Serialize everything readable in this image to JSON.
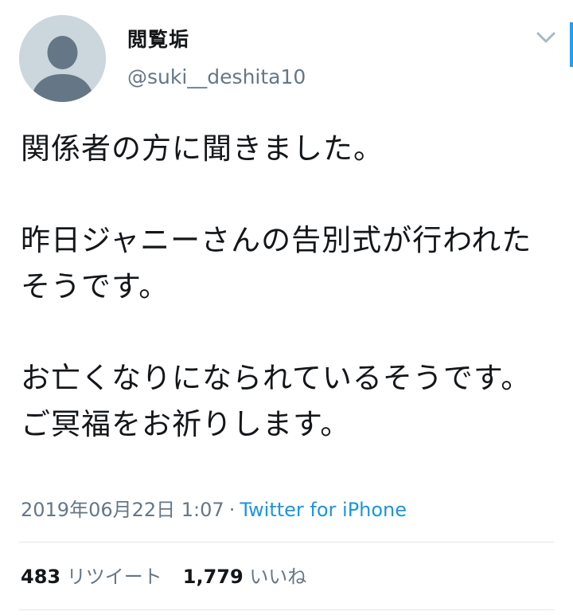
{
  "user": {
    "display_name": "閲覧垢",
    "handle": "@suki__deshita10"
  },
  "tweet": {
    "text": "関係者の方に聞きました。\n\n昨日ジャニーさんの告別式が行われたそうです。\n\nお亡くなりになられているそうです。\nご冥福をお祈りします。",
    "timestamp": "2019年06月22日 1:07",
    "separator": "·",
    "source": "Twitter for iPhone"
  },
  "stats": {
    "retweet_count": "483",
    "retweet_label": "リツイート",
    "like_count": "1,779",
    "like_label": "いいね"
  },
  "colors": {
    "text": "#14171a",
    "secondary": "#657786",
    "link": "#1b95e0",
    "accent": "#1da1f2",
    "divider": "#e1e8ed"
  },
  "icons": [
    "default-avatar-icon",
    "chevron-down-icon"
  ]
}
